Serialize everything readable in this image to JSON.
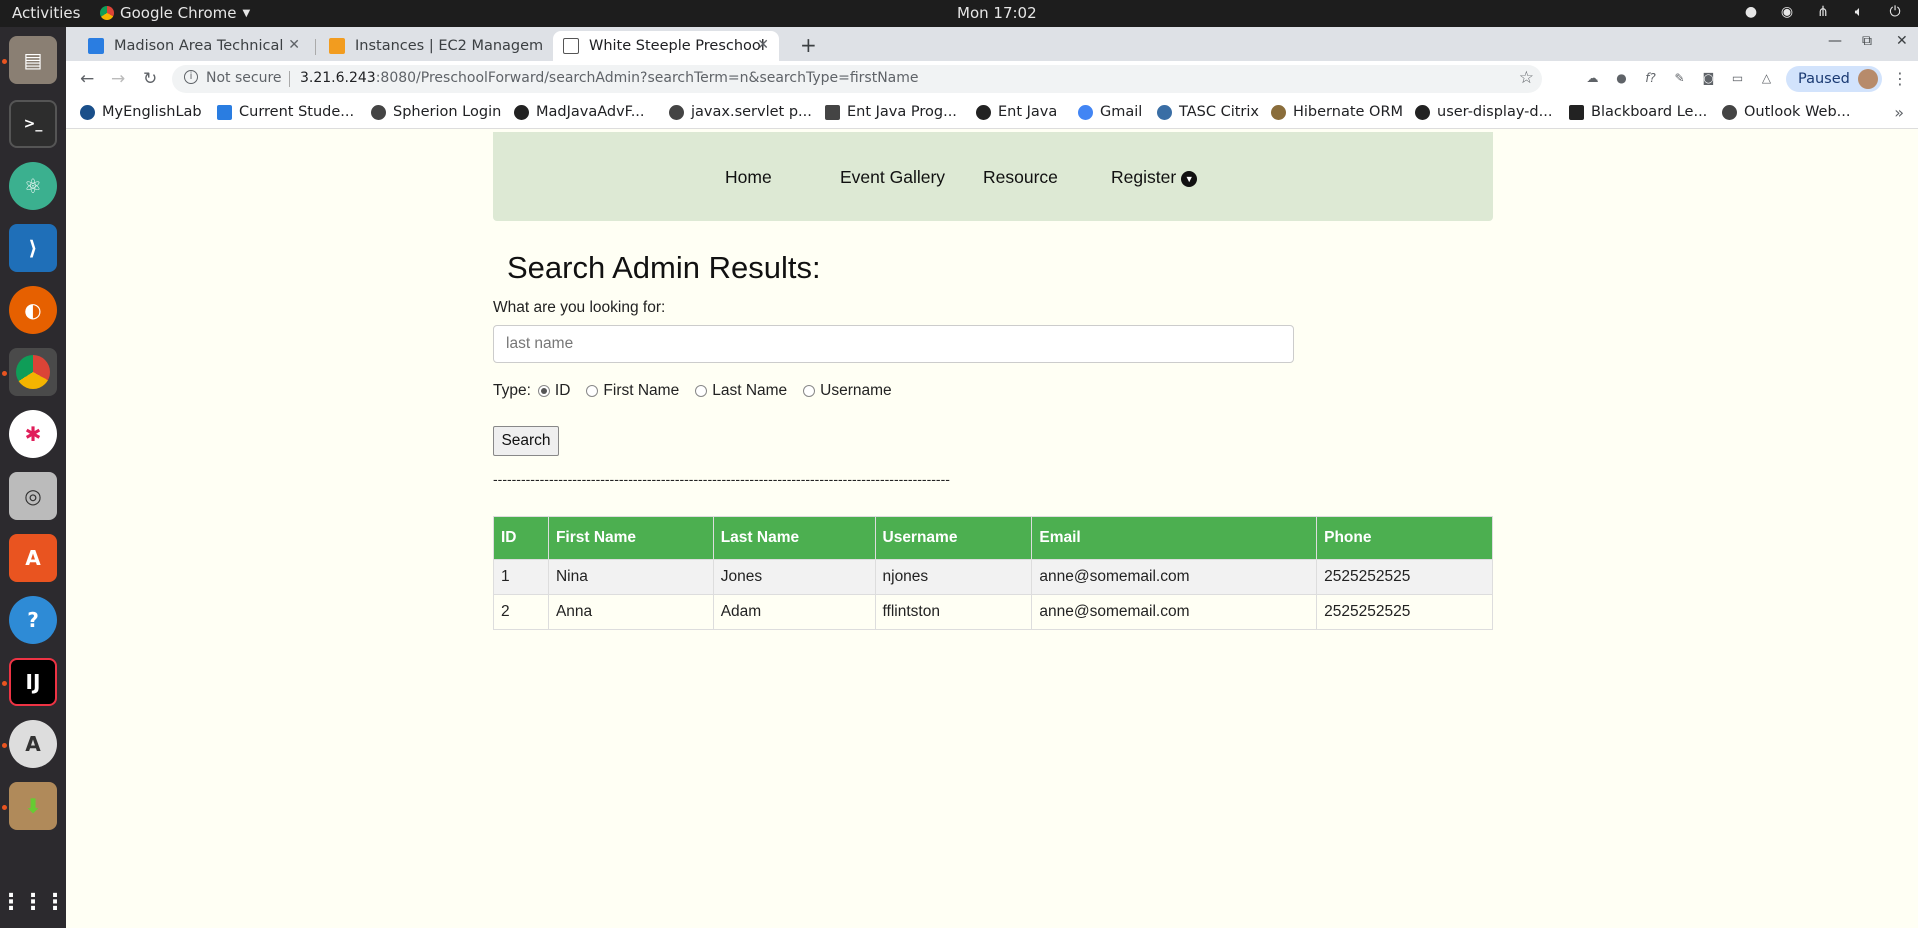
{
  "topbar": {
    "activities": "Activities",
    "app_name": "Google Chrome",
    "clock": "Mon 17:02"
  },
  "dock": {
    "icons": [
      "files-icon",
      "terminal-icon",
      "atom-icon",
      "vscode-icon",
      "firefox-icon",
      "chrome-icon",
      "slack-icon",
      "camera-icon",
      "software-store-icon",
      "help-icon",
      "intellij-icon",
      "updater-icon",
      "archive-install-icon",
      "show-apps-icon"
    ]
  },
  "browser": {
    "tabs": [
      {
        "title": "Madison Area Technical C",
        "favicon_color": "#2a7de1"
      },
      {
        "title": "Instances | EC2 Managem",
        "favicon_color": "#f29c1f"
      },
      {
        "title": "White Steeple Preschool",
        "favicon_color": "#555555"
      }
    ],
    "security": "Not secure",
    "url_host": "3.21.6.243",
    "url_path": ":8080/PreschoolForward/searchAdmin?searchTerm=n&searchType=firstName",
    "paused_label": "Paused",
    "bookmarks": [
      "MyEnglishLab",
      "Current Stude...",
      "Spherion Login",
      "MadJavaAdvF...",
      "javax.servlet p...",
      "Ent Java Prog...",
      "Ent Java",
      "Gmail",
      "TASC Citrix",
      "Hibernate ORM",
      "user-display-d...",
      "Blackboard Le...",
      "Outlook Web..."
    ]
  },
  "page": {
    "nav": {
      "home": "Home",
      "gallery": "Event Gallery",
      "resource": "Resource",
      "register": "Register"
    },
    "heading": "Search Admin Results:",
    "look_for_label": "What are you looking for:",
    "search_placeholder": "last name",
    "type_label": "Type:",
    "types": [
      "ID",
      "First Name",
      "Last Name",
      "Username"
    ],
    "selected_type": "ID",
    "search_button": "Search",
    "divider": "--------------------------------------------------------------------------------------------------",
    "table": {
      "headers": [
        "ID",
        "First Name",
        "Last Name",
        "Username",
        "Email",
        "Phone"
      ],
      "rows": [
        [
          "1",
          "Nina",
          "Jones",
          "njones",
          "anne@somemail.com",
          "2525252525"
        ],
        [
          "2",
          "Anna",
          "Adam",
          "fflintston",
          "anne@somemail.com",
          "2525252525"
        ]
      ]
    },
    "colors": {
      "header_green": "#4caf50",
      "nav_bg": "#dde9d4",
      "page_bg": "#fffff4"
    }
  }
}
